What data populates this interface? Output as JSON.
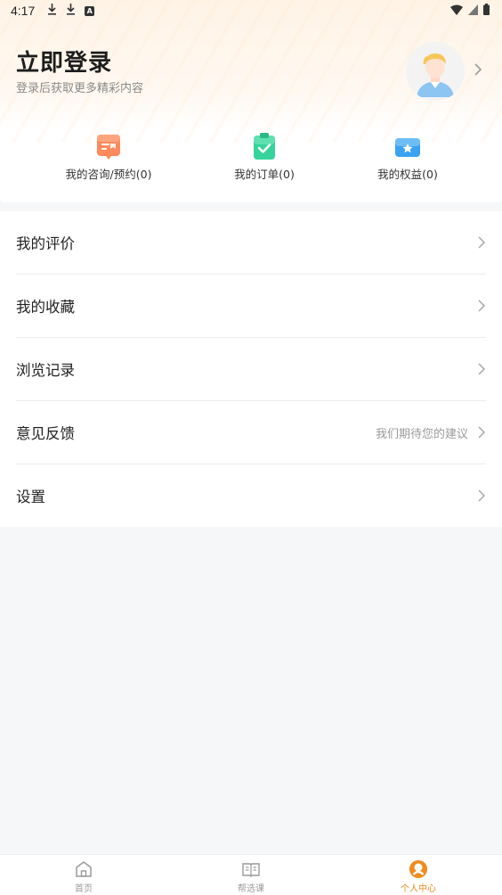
{
  "status_bar": {
    "time": "4:17",
    "icons": [
      "download-icon",
      "download-icon",
      "font-icon"
    ],
    "right_icons": [
      "wifi-icon",
      "signal-icon",
      "battery-icon"
    ]
  },
  "header": {
    "title": "立即登录",
    "subtitle": "登录后获取更多精彩内容",
    "avatar_icon": "user-avatar-icon"
  },
  "quick_actions": [
    {
      "label": "我的咨询/预约(0)",
      "icon": "consult-icon",
      "color": "#ff8a5c"
    },
    {
      "label": "我的订单(0)",
      "icon": "order-clipboard-icon",
      "color": "#36d49a"
    },
    {
      "label": "我的权益(0)",
      "icon": "benefit-box-icon",
      "color": "#3aa2f0"
    }
  ],
  "menu": [
    {
      "label": "我的评价",
      "hint": ""
    },
    {
      "label": "我的收藏",
      "hint": ""
    },
    {
      "label": "浏览记录",
      "hint": ""
    },
    {
      "label": "意见反馈",
      "hint": "我们期待您的建议"
    },
    {
      "label": "设置",
      "hint": ""
    }
  ],
  "tabbar": {
    "tabs": [
      {
        "label": "首页",
        "icon": "home-icon"
      },
      {
        "label": "帮选课",
        "icon": "book-icon"
      },
      {
        "label": "个人中心",
        "icon": "profile-icon"
      }
    ],
    "active_index": 2,
    "active_color": "#f28a1c"
  }
}
